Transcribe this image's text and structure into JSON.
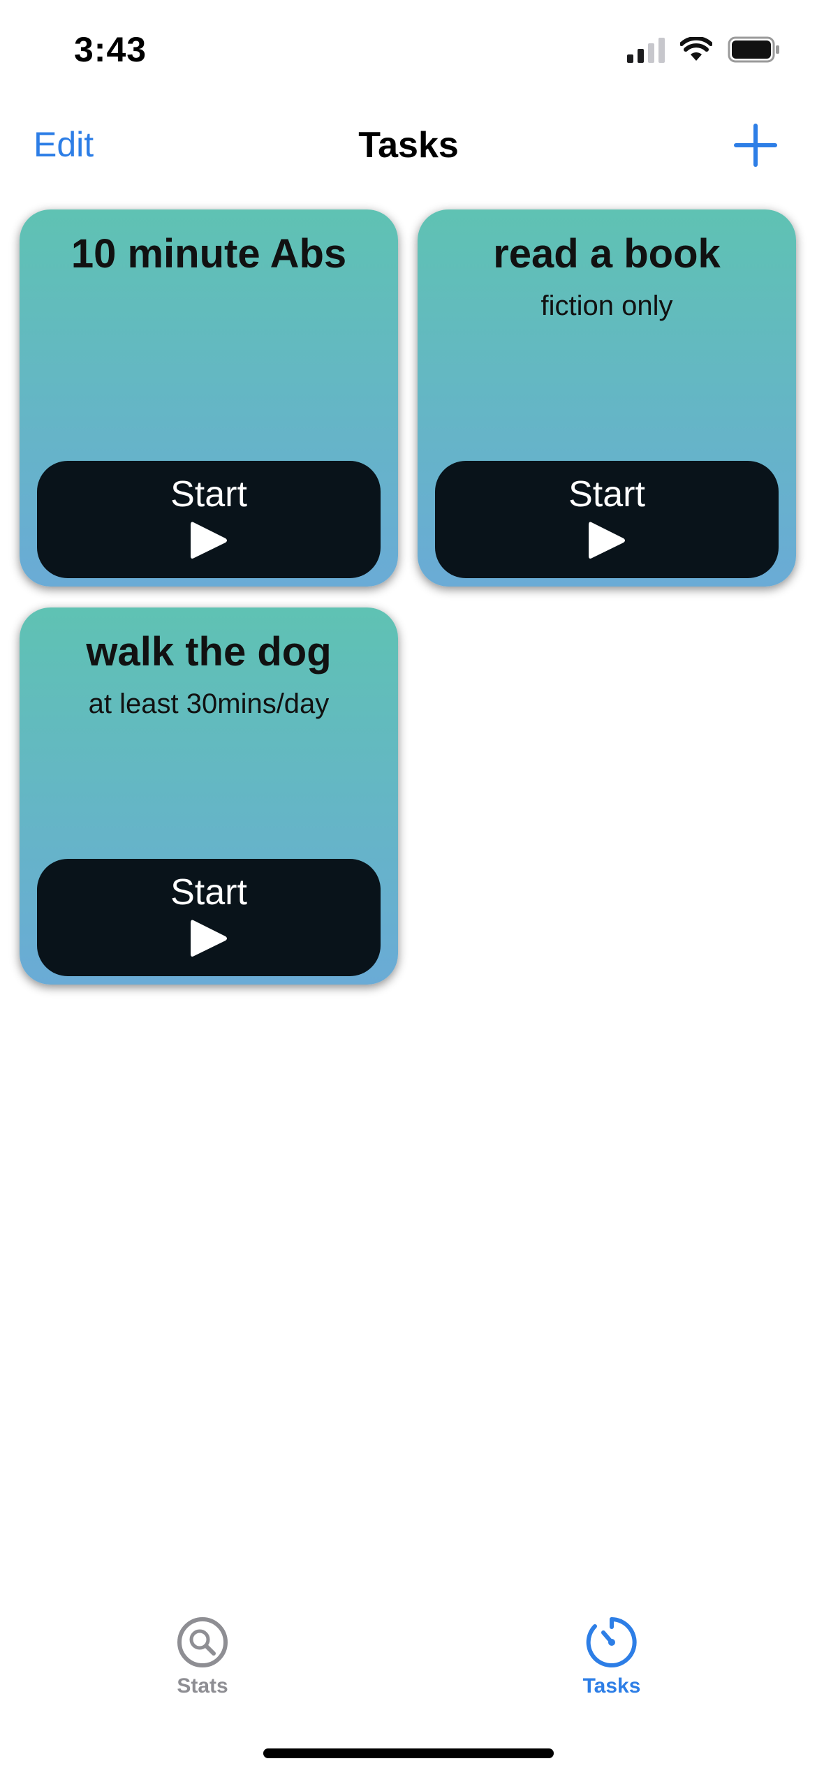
{
  "status_bar": {
    "time": "3:43",
    "icons": [
      "cellular-signal-icon",
      "wifi-icon",
      "battery-icon"
    ]
  },
  "nav": {
    "edit_label": "Edit",
    "title": "Tasks",
    "add_icon": "plus-icon"
  },
  "tasks": [
    {
      "title": "10 minute Abs",
      "subtitle": "",
      "button_label": "Start"
    },
    {
      "title": "read a book",
      "subtitle": "fiction only",
      "button_label": "Start"
    },
    {
      "title": "walk the dog",
      "subtitle": "at least 30mins/day",
      "button_label": "Start"
    }
  ],
  "tab_bar": {
    "tabs": [
      {
        "label": "Stats",
        "icon": "magnifier-icon",
        "selected": false
      },
      {
        "label": "Tasks",
        "icon": "timer-icon",
        "selected": true
      }
    ]
  },
  "colors": {
    "accent": "#2d7ee6",
    "card_gradient_top": "#5fc2b3",
    "card_gradient_bottom": "#6aabd6",
    "button_bg": "#09131a",
    "tab_inactive": "#8e8e93"
  }
}
